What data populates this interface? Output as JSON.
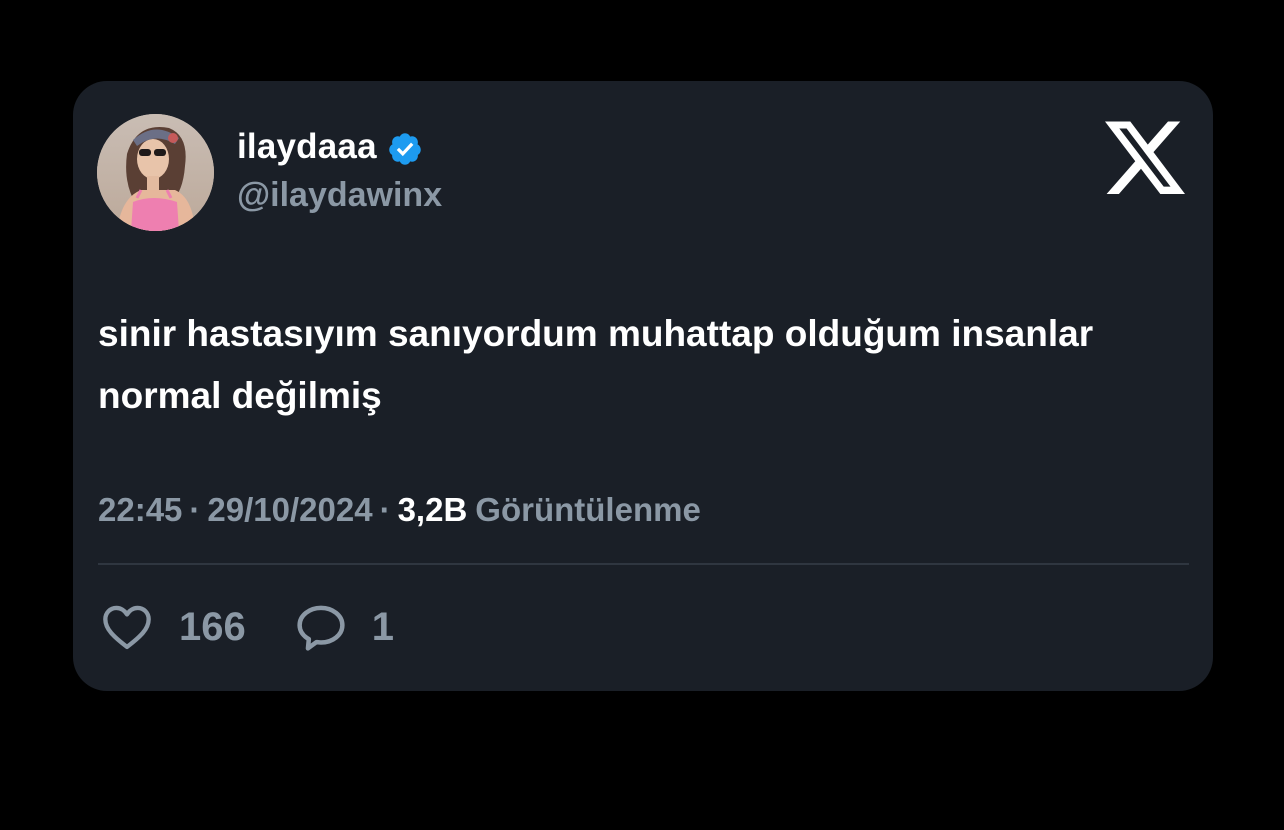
{
  "tweet": {
    "author": {
      "display_name": "ilaydaaa",
      "handle": "@ilaydawinx",
      "verified": true,
      "verified_color": "#1d9bf0"
    },
    "text": "sinir hastasıyım sanıyordum muhattap olduğum insanlar normal değilmiş",
    "time": "22:45",
    "date": "29/10/2024",
    "separator": "·",
    "views_count": "3,2B",
    "views_label": "Görüntülenme",
    "likes_count": "166",
    "replies_count": "1"
  },
  "icons": {
    "platform": "x-logo-icon",
    "verified": "verified-badge-icon",
    "like": "heart-icon",
    "reply": "speech-bubble-icon"
  },
  "colors": {
    "page_background": "#000000",
    "card_background": "#1a1f27",
    "primary_text": "#ffffff",
    "secondary_text": "#8b98a5"
  }
}
